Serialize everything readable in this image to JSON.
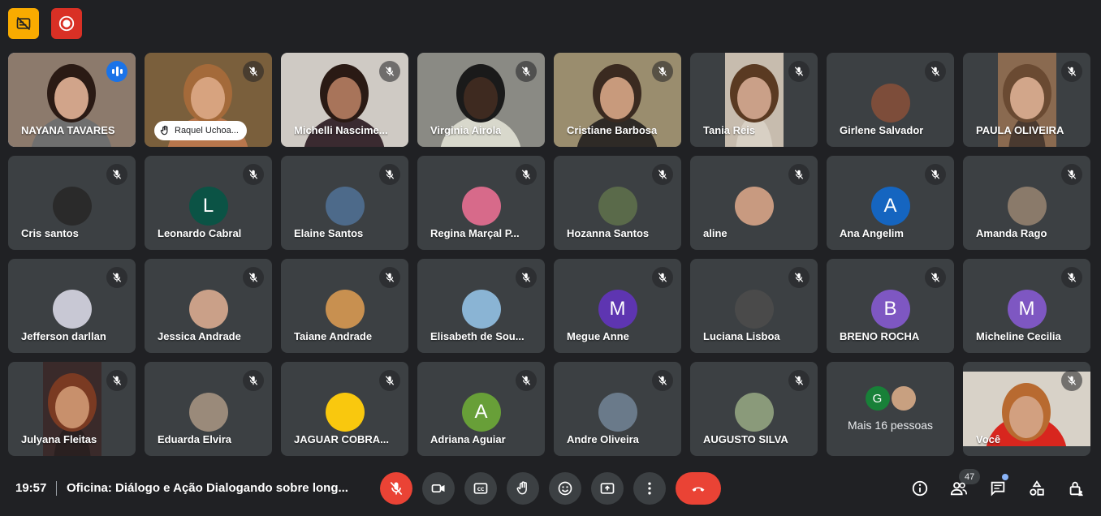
{
  "participants": [
    {
      "name": "NAYANA TAVARES",
      "kind": "video",
      "speaking": true,
      "bg": "#8c7a6c",
      "skin": "#d1a48a",
      "hair": "#2a1a14",
      "shirt": "#6f6f6f"
    },
    {
      "name": "Raquel Uchoa...",
      "kind": "video",
      "pill": true,
      "bg": "#7a5f3c",
      "skin": "#d7a37f",
      "hair": "#a46a3a",
      "shirt": "#b8764c"
    },
    {
      "name": "Michelli Nascime...",
      "kind": "video",
      "bg": "#cfcac4",
      "skin": "#a8745a",
      "hair": "#2a1a14",
      "shirt": "#3a2a30"
    },
    {
      "name": "Virginia Airola",
      "kind": "video",
      "bg": "#8a8a84",
      "skin": "#3e2a20",
      "hair": "#1a1a1a",
      "shirt": "#d8d8cc"
    },
    {
      "name": "Cristiane Barbosa",
      "kind": "video",
      "bg": "#9a8d6e",
      "skin": "#c89a7c",
      "hair": "#3a2a20",
      "shirt": "#2e2a26"
    },
    {
      "name": "Tania Reis",
      "kind": "portrait",
      "bg": "#c7bcae",
      "skin": "#caa088",
      "hair": "#5a3a22",
      "shirt": "#d8d0c4"
    },
    {
      "name": "Girlene Salvador",
      "kind": "avatar",
      "color": "#7d4d3a"
    },
    {
      "name": "PAULA OLIVEIRA",
      "kind": "portrait",
      "bg": "#8a6a50",
      "skin": "#d2a68a",
      "hair": "#6a4a32",
      "shirt": "#4a3a30"
    },
    {
      "name": "Cris santos",
      "kind": "avatar",
      "color": "#2a2a2a"
    },
    {
      "name": "Leonardo Cabral",
      "kind": "avatar",
      "letter": "L",
      "color": "#0b5345"
    },
    {
      "name": "Elaine Santos",
      "kind": "avatar",
      "color": "#4d6a8a"
    },
    {
      "name": "Regina Marçal P...",
      "kind": "avatar",
      "color": "#d76a8a"
    },
    {
      "name": "Hozanna Santos",
      "kind": "avatar",
      "color": "#5a6a4a"
    },
    {
      "name": "aline",
      "kind": "avatar",
      "color": "#c89a80"
    },
    {
      "name": "Ana Angelim",
      "kind": "avatar",
      "letter": "A",
      "color": "#1565c0"
    },
    {
      "name": "Amanda Rago",
      "kind": "avatar",
      "color": "#8a7a6a"
    },
    {
      "name": "Jefferson darllan",
      "kind": "avatar",
      "color": "#c8c8d4"
    },
    {
      "name": "Jessica Andrade",
      "kind": "avatar",
      "color": "#caa088"
    },
    {
      "name": "Taiane Andrade",
      "kind": "avatar",
      "color": "#c89050"
    },
    {
      "name": "Elisabeth de Sou...",
      "kind": "avatar",
      "color": "#8ab4d4"
    },
    {
      "name": "Megue Anne",
      "kind": "avatar",
      "letter": "M",
      "color": "#5e35b1"
    },
    {
      "name": "Luciana Lisboa",
      "kind": "avatar",
      "color": "#4a4a4a"
    },
    {
      "name": "BRENO ROCHA",
      "kind": "avatar",
      "letter": "B",
      "color": "#7e57c2"
    },
    {
      "name": "Micheline Cecilia",
      "kind": "avatar",
      "letter": "M",
      "color": "#7e57c2"
    },
    {
      "name": "Julyana Fleitas",
      "kind": "portrait",
      "bg": "#3a2a2a",
      "skin": "#c8906c",
      "hair": "#7a3a22",
      "shirt": "#2a2020"
    },
    {
      "name": "Eduarda Elvira",
      "kind": "avatar",
      "color": "#9a8a7a"
    },
    {
      "name": "JAGUAR COBRA...",
      "kind": "avatar",
      "color": "#f9c80e"
    },
    {
      "name": "Adriana Aguiar",
      "kind": "avatar",
      "letter": "A",
      "color": "#689f38"
    },
    {
      "name": "Andre Oliveira",
      "kind": "avatar",
      "color": "#6a7a8a"
    },
    {
      "name": "AUGUSTO SILVA",
      "kind": "avatar",
      "color": "#8a9a7a"
    },
    {
      "kind": "more",
      "label": "Mais 16 pessoas",
      "letter": "G",
      "color": "#188038",
      "color2": "#c8a080"
    },
    {
      "name": "Você",
      "kind": "self",
      "bg": "#d8d2c8",
      "skin": "#d2a080",
      "hair": "#b86a30",
      "shirt": "#d8261e"
    }
  ],
  "bottom_bar": {
    "time": "19:57",
    "meeting_title": "Oficina: Diálogo e Ação Dialogando sobre long...",
    "participant_count": "47"
  }
}
